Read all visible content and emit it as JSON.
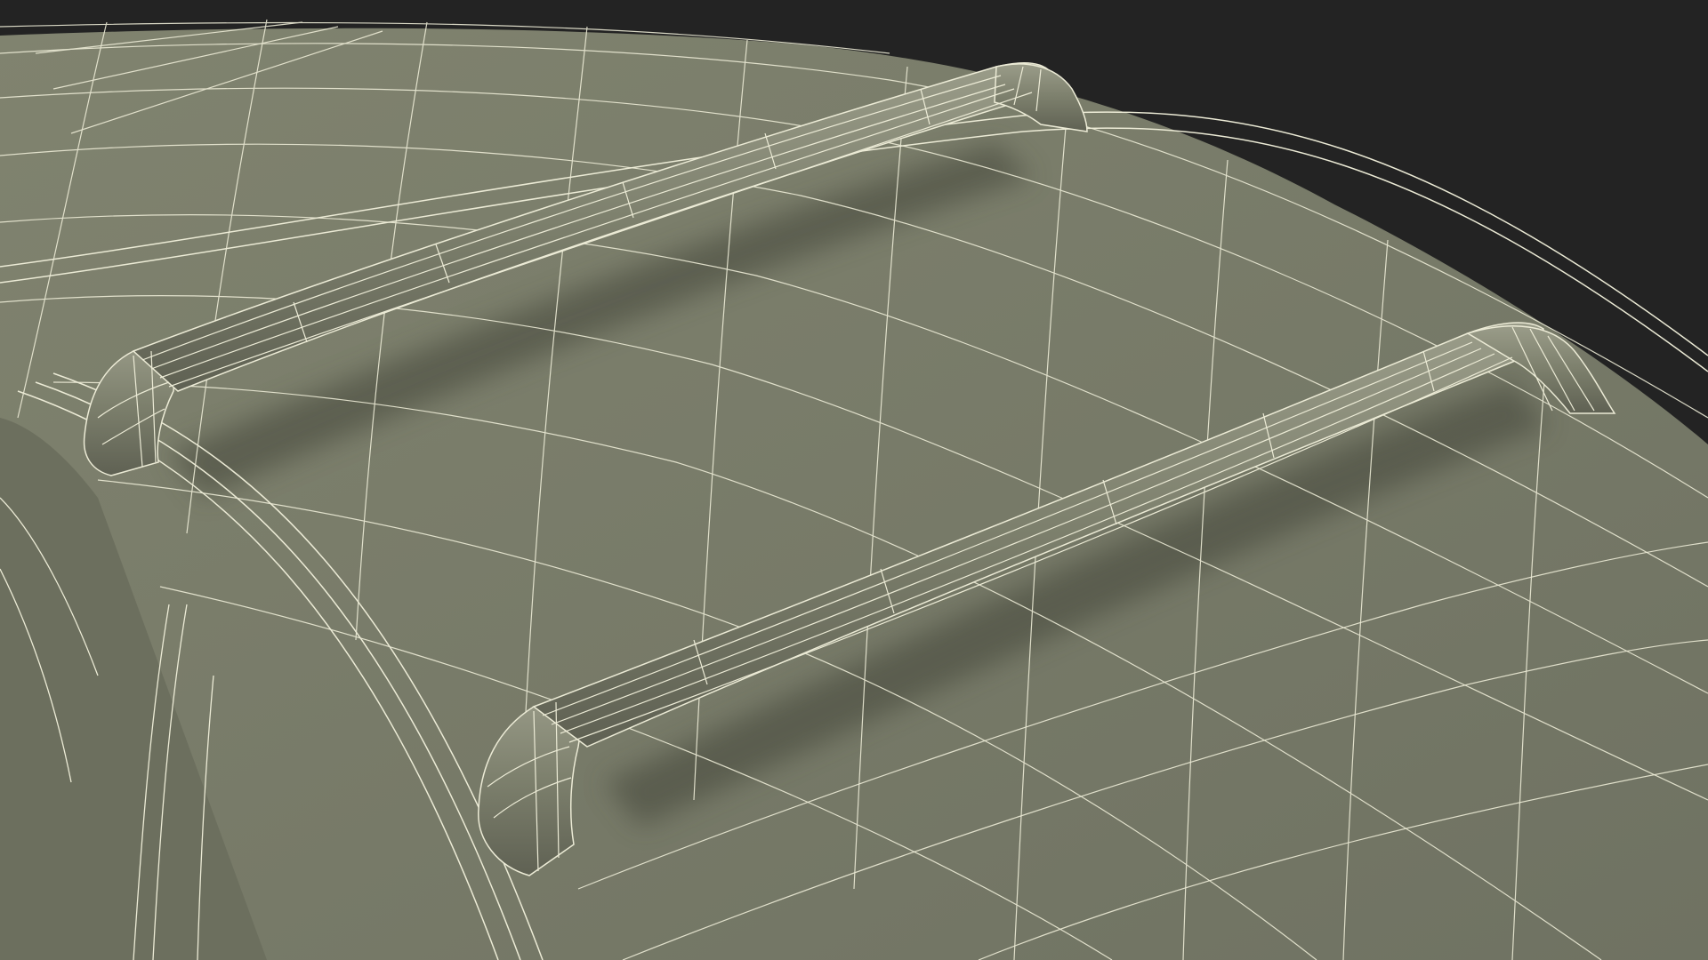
{
  "scene": {
    "subject": "roof-rack-crossbars-on-car-roof",
    "render_style": "wireframe-over-shaded",
    "colors": {
      "background": "#232323",
      "surface": "#777a68",
      "surface_dark": "#5d5f51",
      "surface_light": "#8a8c7b",
      "wire": "#ecebd6",
      "shadow": "#45473b"
    },
    "crossbars": [
      {
        "name": "rear-crossbar"
      },
      {
        "name": "front-crossbar"
      }
    ]
  }
}
